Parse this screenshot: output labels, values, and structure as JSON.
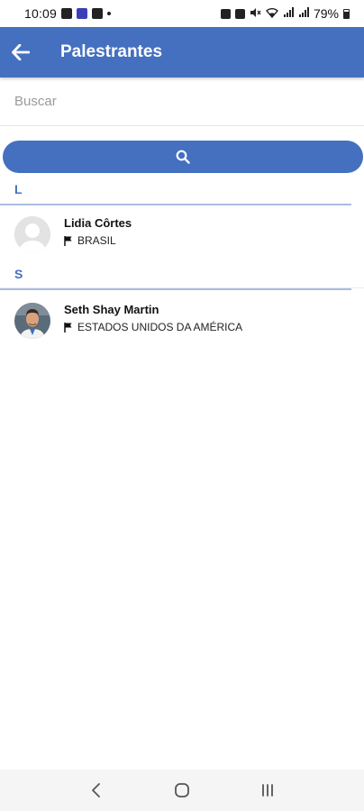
{
  "status_bar": {
    "time": "10:09",
    "battery_text": "79%"
  },
  "app_bar": {
    "title": "Palestrantes",
    "back_icon": "arrow-left-icon"
  },
  "search": {
    "placeholder": "Buscar",
    "value": "",
    "button_icon": "search-icon"
  },
  "colors": {
    "primary": "#4470bf",
    "section_rule": "#a7bde0"
  },
  "sections": [
    {
      "letter": "L",
      "speakers": [
        {
          "name": "Lidia Côrtes",
          "country": "BRASIL",
          "avatar": "placeholder"
        }
      ]
    },
    {
      "letter": "S",
      "speakers": [
        {
          "name": "Seth Shay Martin",
          "country": "ESTADOS UNIDOS DA AMÉRICA",
          "avatar": "photo"
        }
      ]
    }
  ],
  "nav_bar": {
    "back_icon": "nav-back-icon",
    "home_icon": "nav-home-icon",
    "recents_icon": "nav-recents-icon"
  }
}
